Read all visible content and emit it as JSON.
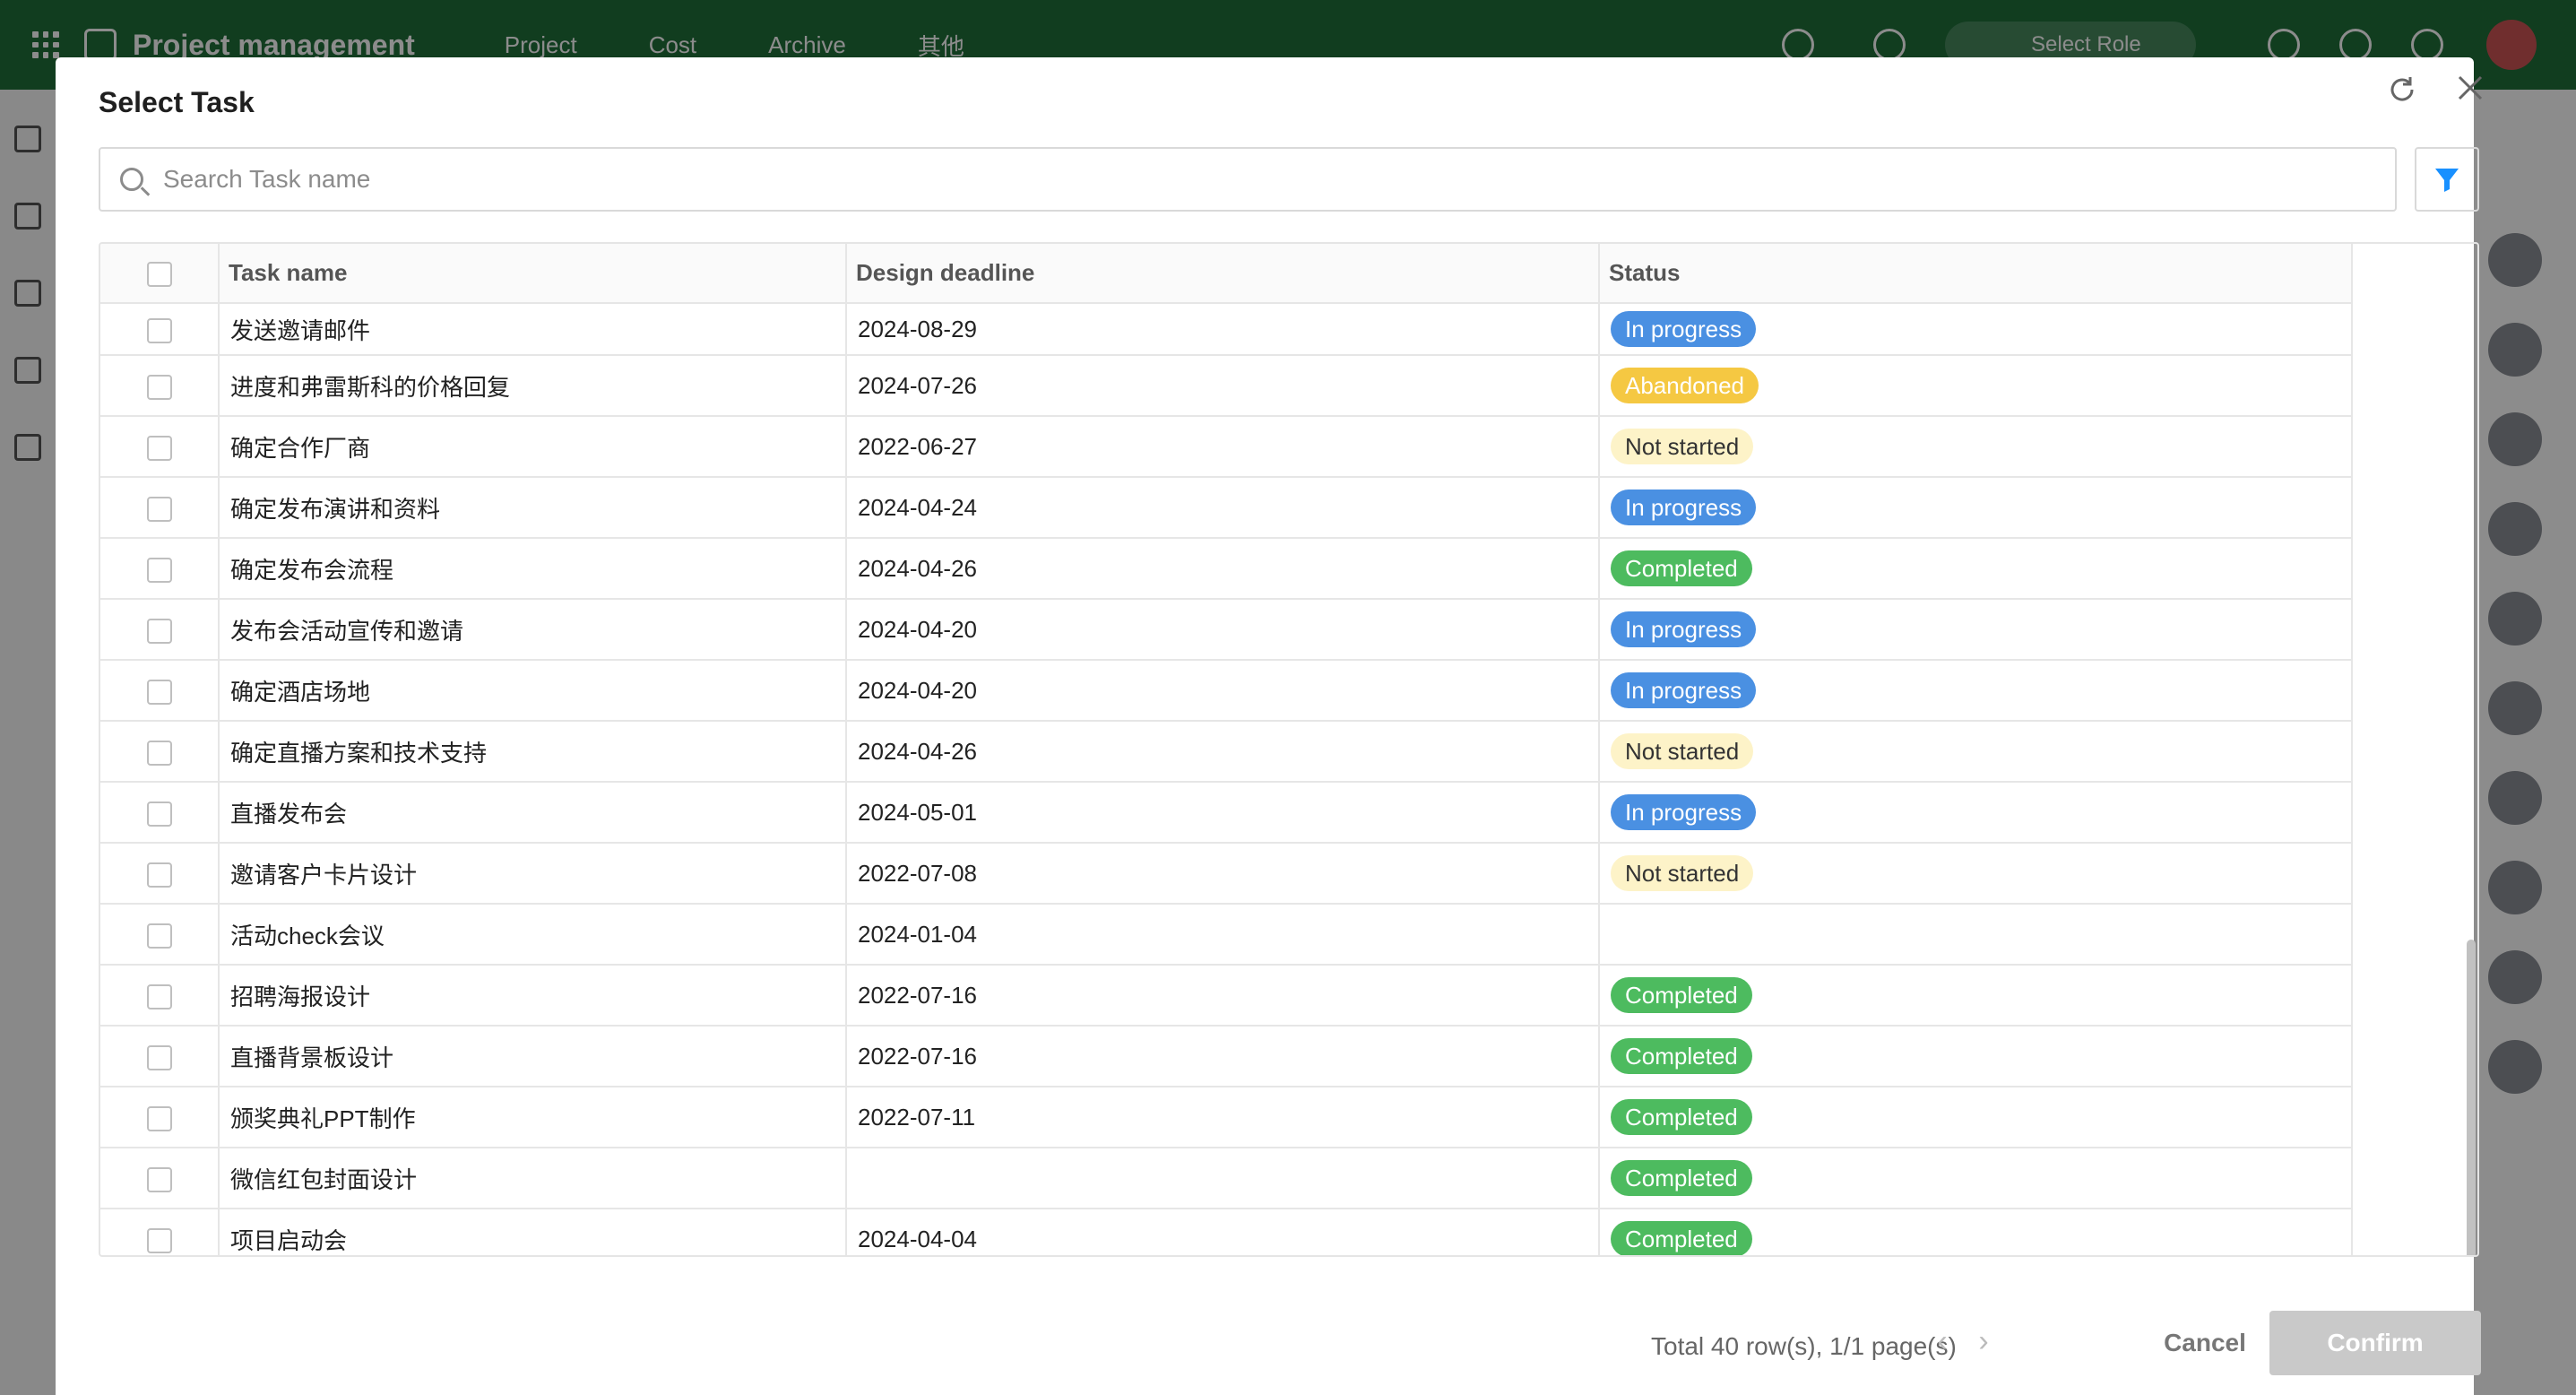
{
  "background": {
    "app_title": "Project management",
    "nav": [
      "Project",
      "Cost",
      "Archive",
      "其他"
    ],
    "role_select": "Select Role"
  },
  "dialog": {
    "title": "Select Task",
    "search_placeholder": "Search Task name",
    "columns": {
      "task": "Task name",
      "deadline": "Design deadline",
      "status": "Status"
    },
    "status_colors": {
      "In progress": {
        "bg": "#4a90e2",
        "fg": "#ffffff"
      },
      "Abandoned": {
        "bg": "#f5c842",
        "fg": "#ffffff"
      },
      "Not started": {
        "bg": "#fdf3c8",
        "fg": "#333333"
      },
      "Completed": {
        "bg": "#4dbb5f",
        "fg": "#ffffff"
      }
    },
    "rows": [
      {
        "task": "发送邀请邮件",
        "deadline": "2024-08-29",
        "status": "In progress"
      },
      {
        "task": "进度和弗雷斯科的价格回复",
        "deadline": "2024-07-26",
        "status": "Abandoned"
      },
      {
        "task": "确定合作厂商",
        "deadline": "2022-06-27",
        "status": "Not started"
      },
      {
        "task": "确定发布演讲和资料",
        "deadline": "2024-04-24",
        "status": "In progress"
      },
      {
        "task": "确定发布会流程",
        "deadline": "2024-04-26",
        "status": "Completed"
      },
      {
        "task": "发布会活动宣传和邀请",
        "deadline": "2024-04-20",
        "status": "In progress"
      },
      {
        "task": "确定酒店场地",
        "deadline": "2024-04-20",
        "status": "In progress"
      },
      {
        "task": "确定直播方案和技术支持",
        "deadline": "2024-04-26",
        "status": "Not started"
      },
      {
        "task": "直播发布会",
        "deadline": "2024-05-01",
        "status": "In progress"
      },
      {
        "task": "邀请客户卡片设计",
        "deadline": "2022-07-08",
        "status": "Not started"
      },
      {
        "task": "活动check会议",
        "deadline": "2024-01-04",
        "status": ""
      },
      {
        "task": "招聘海报设计",
        "deadline": "2022-07-16",
        "status": "Completed"
      },
      {
        "task": "直播背景板设计",
        "deadline": "2022-07-16",
        "status": "Completed"
      },
      {
        "task": "颁奖典礼PPT制作",
        "deadline": "2022-07-11",
        "status": "Completed"
      },
      {
        "task": "微信红包封面设计",
        "deadline": "",
        "status": "Completed"
      },
      {
        "task": "项目启动会",
        "deadline": "2024-04-04",
        "status": "Completed"
      }
    ],
    "footer": {
      "total": "Total 40 row(s), 1/1 page(s)",
      "cancel": "Cancel",
      "confirm": "Confirm"
    },
    "accent": "#1890ff"
  }
}
